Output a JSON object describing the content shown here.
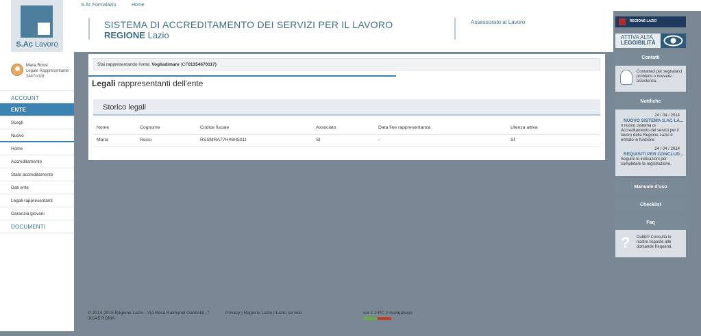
{
  "top_nav": {
    "site_link": "S.Ac Formalazio",
    "home_link": "Home"
  },
  "logo": {
    "brand": "S.Ac",
    "brand_suffix": "Lavoro"
  },
  "user": {
    "name": "Maria Rossi",
    "role": "Legale Rappresentante",
    "id": "3447oriz8"
  },
  "sidebar": {
    "account": "ACCOUNT",
    "ente": "ENTE",
    "scegli": "Scegli",
    "nuovo": "Nuovo",
    "home": "Home",
    "accreditamento": "Accreditamento",
    "stato_accreditamento": "Stato accreditamento",
    "dati_ente": "Dati ente",
    "legali_rappresentanti": "Legali rappresentanti",
    "garanzia_giovani": "Garanzia giovani",
    "documenti": "DOCUMENTI"
  },
  "header": {
    "title_line1": "SISTEMA DI ACCREDITAMENTO DEI SERVIZI PER IL LAVORO",
    "title_bold": "REGIONE",
    "title_rest": "Lazio",
    "assessorato": "Assessorato al Lavoro"
  },
  "representing": {
    "prefix": "Stai rappresentando l'ente:",
    "ente_name": "Vogliadimare",
    "cf_prefix": "(CF",
    "cf_value": "01354670117)"
  },
  "page": {
    "title_bold": "Legali",
    "title_rest": "rappresentanti dell'ente",
    "section": "Storico legali"
  },
  "table": {
    "headers": [
      "Nome",
      "Cognome",
      "Codice fiscale",
      "Associato",
      "Data fine rappresentanza",
      "Utenza attiva"
    ],
    "rows": [
      [
        "Maria",
        "Rossi",
        "RSSMRA77H46H501I",
        "SI",
        "-",
        "SI"
      ]
    ]
  },
  "right_panel": {
    "brand_name": "REGIONE LAZIO",
    "accessibility_line1": "ATTIVA ALTA",
    "accessibility_line2": "LEGGIBILITÀ",
    "contatti": "Contatti",
    "contatti_text": "Contattaci per segnalarci problemi o ricevere assistenza.",
    "notifiche": "Notifiche",
    "notifications": [
      {
        "date": "24 / 04 / 2014",
        "title": "NUOVO SISTEMA S.AC LA...",
        "text": "Il nuovo Sistema di Accreditamento dei servizi per il lavoro della Regione Lazio è entrato in funzione"
      },
      {
        "date": "24 / 04 / 2014",
        "title": "REQUISITI PER CONCLUD...",
        "text": "Seguire le indicazioni per completare la registrazione."
      }
    ],
    "manuale": "Manuale d'uso",
    "checklist": "Checklist",
    "faq": "Faq",
    "faq_text": "Dubbi? Consulta le nostre risposte alle domande frequenti."
  },
  "footer": {
    "copyright": "© 2014-2015 Regione Lazio - Via Rosa Raimondi Garibaldi, 7",
    "address": "00145 ROMA",
    "links": "Privacy | Regione Lazio | Lazio service",
    "version": "ver 1.2 RC 2 manganese"
  },
  "colors": {
    "accent": "#3b82b2",
    "brand": "#3b6e8e",
    "panel": "#7a8a97",
    "background": "#7a8895"
  }
}
